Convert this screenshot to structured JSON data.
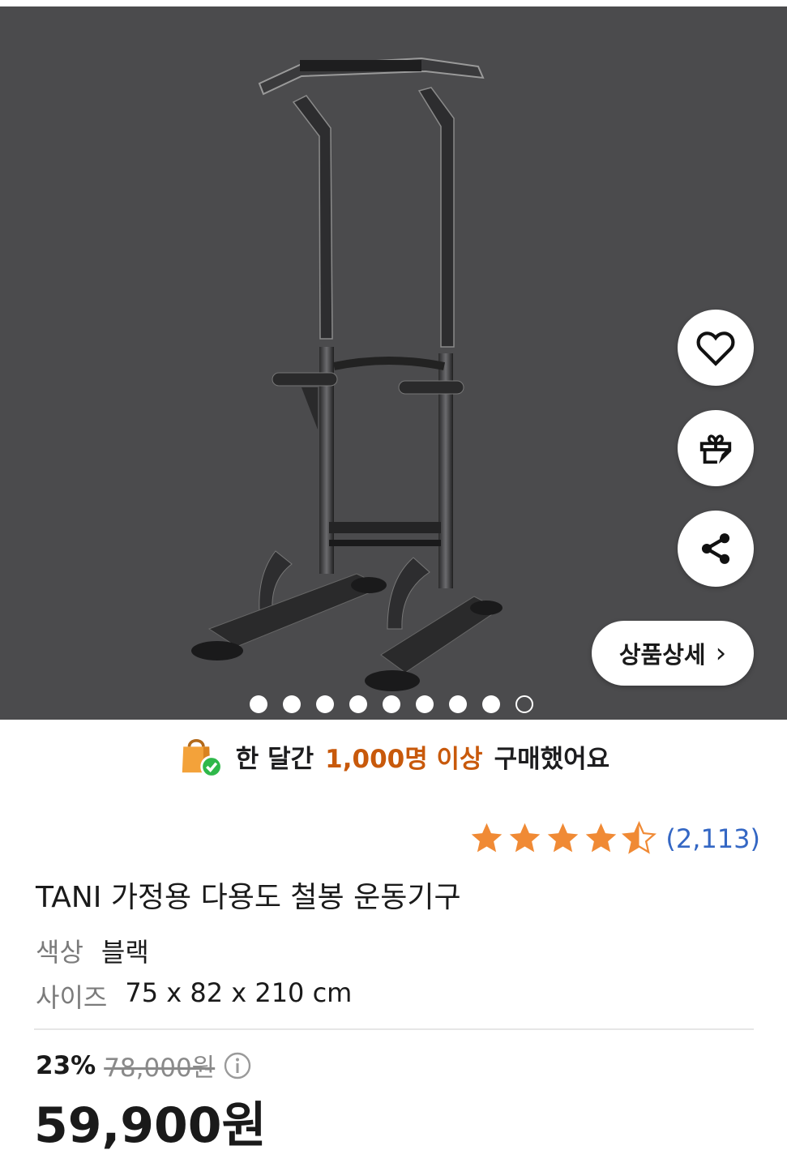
{
  "hero": {
    "image_alt": "power tower pull-up bar",
    "actions": {
      "detail_label": "상품상세",
      "detail_arrow": "›"
    },
    "carousel": {
      "total": 9,
      "current": 9
    }
  },
  "social_proof": {
    "prefix": "한 달간",
    "highlight": "1,000명 이상",
    "suffix": "구매했어요"
  },
  "rating": {
    "stars": 4.5,
    "count": "(2,113)"
  },
  "product": {
    "title": "TANI 가정용 다용도 철봉 운동기구",
    "options": [
      {
        "label": "색상",
        "value": "블랙"
      },
      {
        "label": "사이즈",
        "value": "75 x 82 x 210 cm"
      }
    ]
  },
  "pricing": {
    "discount_rate": "23%",
    "original_price": "78,000원",
    "sale_price": "59,900원"
  },
  "colors": {
    "hero_bg": "#4b4b4d",
    "star": "#f08a35",
    "highlight": "#c8590b",
    "review_link": "#3467c4",
    "badge_green": "#2fb84a"
  }
}
